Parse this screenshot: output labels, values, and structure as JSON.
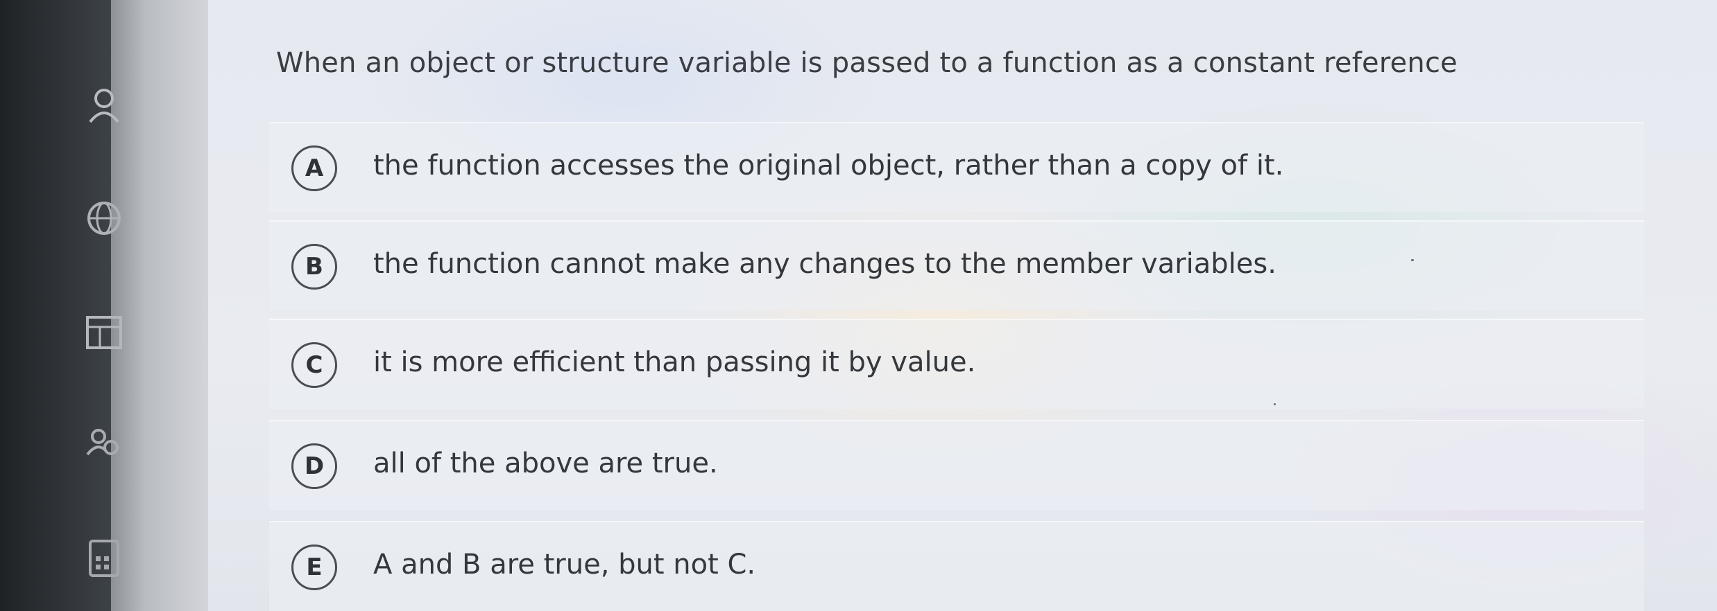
{
  "question": {
    "text": "When an object or structure variable is passed to a function as a constant reference"
  },
  "options": [
    {
      "letter": "A",
      "text": "the function accesses the original object, rather than a copy of it."
    },
    {
      "letter": "B",
      "text": "the function cannot make any changes to the member variables."
    },
    {
      "letter": "C",
      "text": "it is more efficient than passing it by value."
    },
    {
      "letter": "D",
      "text": "all of the above are true."
    },
    {
      "letter": "E",
      "text": "A and B are true, but not C."
    }
  ],
  "sidebar": {
    "icons": [
      "user-icon",
      "globe-icon",
      "table-icon",
      "people-icon",
      "calculator-icon"
    ]
  }
}
